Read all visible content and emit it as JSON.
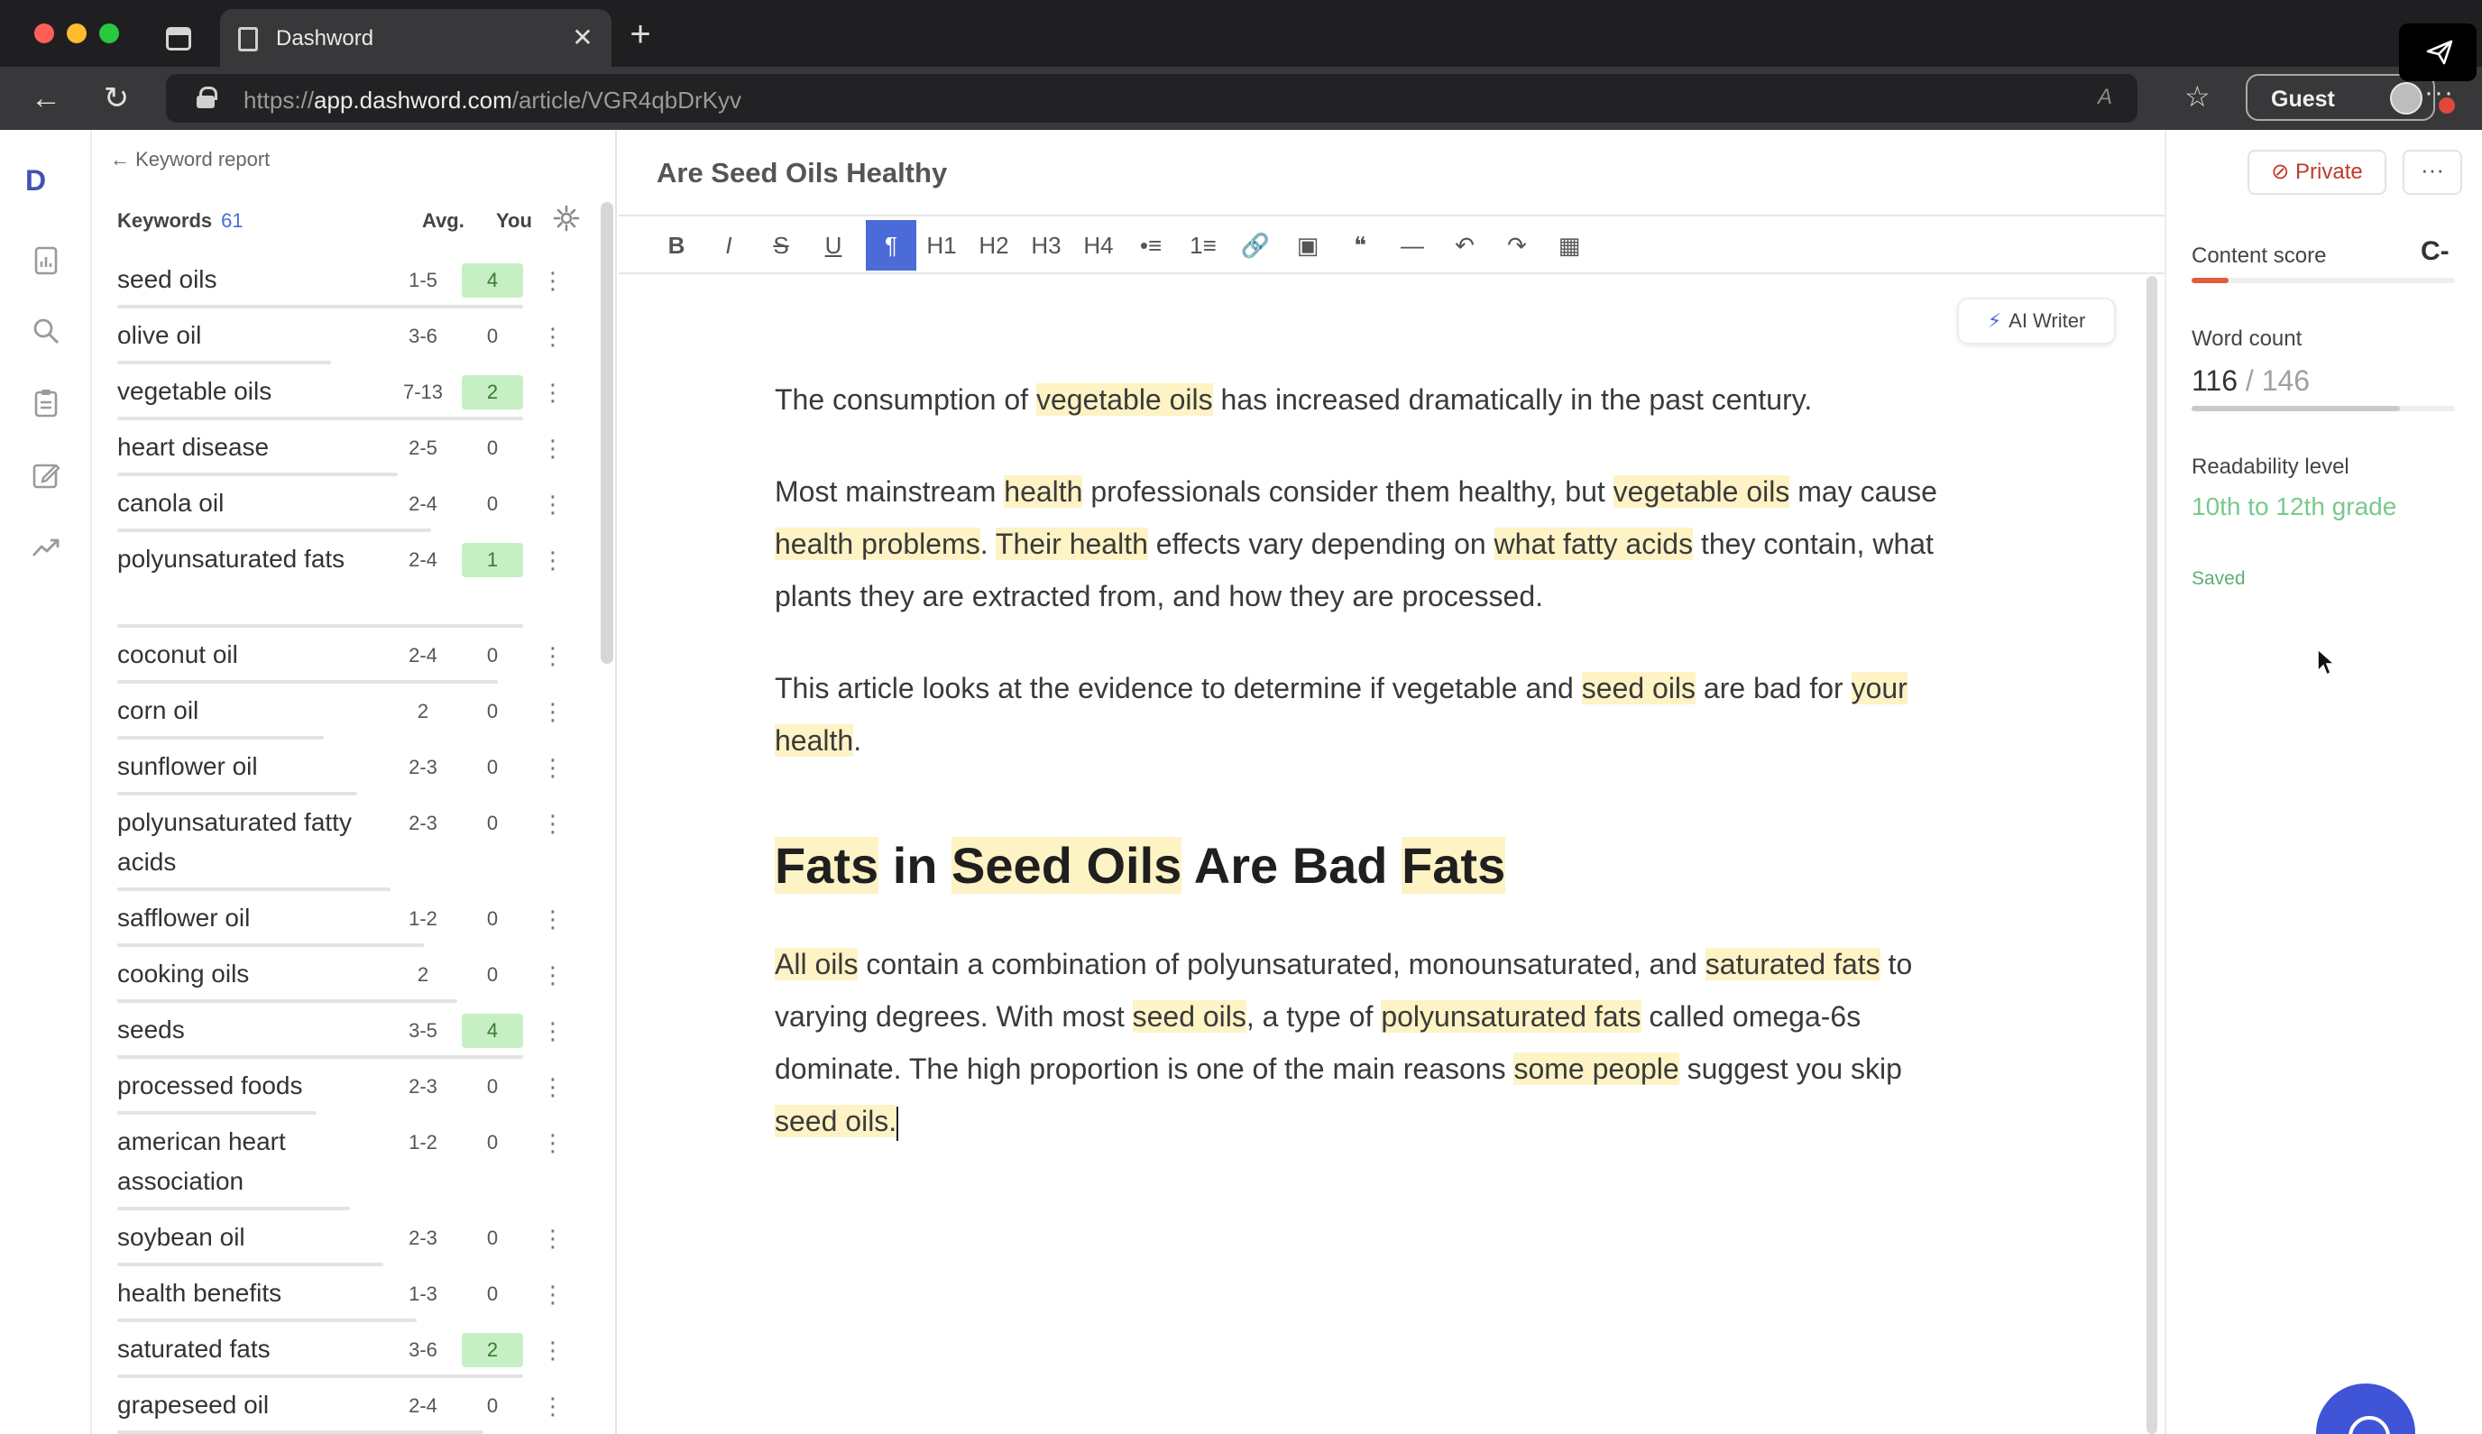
{
  "browser": {
    "tab_title": "Dashword",
    "url_prefix": "https://",
    "url_host": "app.dashword.com",
    "url_path": "/article/VGR4qbDrKyv",
    "read_aloud": "A",
    "profile_label": "Guest"
  },
  "app": {
    "logo": "D",
    "back_link": "← Keyword report",
    "keywords_header": "Keywords",
    "keywords_count": "61",
    "col_avg": "Avg.",
    "col_you": "You",
    "keywords": [
      {
        "name": "seed oils",
        "avg": "1-5",
        "you": "4",
        "hit": true
      },
      {
        "name": "olive oil",
        "avg": "3-6",
        "you": "0",
        "hit": false
      },
      {
        "name": "vegetable oils",
        "avg": "7-13",
        "you": "2",
        "hit": true
      },
      {
        "name": "heart disease",
        "avg": "2-5",
        "you": "0",
        "hit": false
      },
      {
        "name": "canola oil",
        "avg": "2-4",
        "you": "0",
        "hit": false
      },
      {
        "name": "polyunsaturated fats",
        "avg": "2-4",
        "you": "1",
        "hit": true
      },
      {
        "name": "coconut oil",
        "avg": "2-4",
        "you": "0",
        "hit": false
      },
      {
        "name": "corn oil",
        "avg": "2",
        "you": "0",
        "hit": false
      },
      {
        "name": "sunflower oil",
        "avg": "2-3",
        "you": "0",
        "hit": false
      },
      {
        "name": "polyunsaturated fatty acids",
        "avg": "2-3",
        "you": "0",
        "hit": false
      },
      {
        "name": "safflower oil",
        "avg": "1-2",
        "you": "0",
        "hit": false
      },
      {
        "name": "cooking oils",
        "avg": "2",
        "you": "0",
        "hit": false
      },
      {
        "name": "seeds",
        "avg": "3-5",
        "you": "4",
        "hit": true
      },
      {
        "name": "processed foods",
        "avg": "2-3",
        "you": "0",
        "hit": false
      },
      {
        "name": "american heart association",
        "avg": "1-2",
        "you": "0",
        "hit": false
      },
      {
        "name": "soybean oil",
        "avg": "2-3",
        "you": "0",
        "hit": false
      },
      {
        "name": "health benefits",
        "avg": "1-3",
        "you": "0",
        "hit": false
      },
      {
        "name": "saturated fats",
        "avg": "3-6",
        "you": "2",
        "hit": true
      },
      {
        "name": "grapeseed oil",
        "avg": "2-4",
        "you": "0",
        "hit": false
      }
    ],
    "editor": {
      "doc_title": "Are Seed Oils Healthy",
      "ai_writer_label": "AI Writer",
      "toolbar": [
        "B",
        "I",
        "S",
        "U",
        "¶",
        "H1",
        "H2",
        "H3",
        "H4",
        "•≡",
        "1≡",
        "🔗",
        "▣",
        "❝",
        "—",
        "↶",
        "↷",
        "▦"
      ],
      "paragraphs": [
        [
          {
            "t": "The consumption of "
          },
          {
            "t": "vegetable oils",
            "h": true
          },
          {
            "t": " has increased dramatically in the past century."
          }
        ],
        [
          {
            "t": "Most mainstream "
          },
          {
            "t": "health",
            "h": true
          },
          {
            "t": " professionals consider them healthy, but "
          },
          {
            "t": "vegetable oils",
            "h": true
          },
          {
            "t": " may cause "
          },
          {
            "t": "health problems",
            "h": true
          },
          {
            "t": ". "
          },
          {
            "t": "Their health",
            "h": true
          },
          {
            "t": " effects vary depending on "
          },
          {
            "t": "what fatty acids",
            "h": true
          },
          {
            "t": " they contain, what plants they are extracted from, and how they are processed."
          }
        ],
        [
          {
            "t": "This article looks at the evidence to determine if vegetable and "
          },
          {
            "t": "seed oils",
            "h": true
          },
          {
            "t": " are bad for "
          },
          {
            "t": "your health",
            "h": true
          },
          {
            "t": "."
          }
        ]
      ],
      "heading": [
        {
          "t": "Fats",
          "h": true
        },
        {
          "t": " in "
        },
        {
          "t": "Seed Oils",
          "h": true
        },
        {
          "t": " Are Bad "
        },
        {
          "t": "Fats",
          "h": true
        }
      ],
      "paragraph_after": [
        {
          "t": "All oils",
          "h": true
        },
        {
          "t": " contain a combination of polyunsaturated, monounsaturated, and "
        },
        {
          "t": "saturated fats",
          "h": true
        },
        {
          "t": " to varying degrees. With most "
        },
        {
          "t": "seed oils",
          "h": true
        },
        {
          "t": ", a type of "
        },
        {
          "t": "polyunsaturated fats",
          "h": true
        },
        {
          "t": " called omega-6s dominate. The high proportion is one of the main reasons "
        },
        {
          "t": "some people",
          "h": true
        },
        {
          "t": " suggest you skip "
        },
        {
          "t": "seed oils.",
          "h": true
        }
      ]
    },
    "sidebar_right": {
      "private_label": "Private",
      "more_label": "···",
      "content_score_label": "Content score",
      "content_score_grade": "C-",
      "content_score_fraction": 0.14,
      "word_count_label": "Word count",
      "word_count": "116",
      "word_count_target": "/ 146",
      "word_count_fraction": 0.79,
      "readability_label": "Readability level",
      "readability_value": "10th to 12th grade",
      "saved_label": "Saved"
    }
  },
  "colors": {
    "accent": "#4a6bd8",
    "highlight": "#fdf3c5",
    "keyword_hit_bg": "#c6efc3",
    "score_bar": "#e05d3c",
    "readability_green": "#79c98d",
    "private_red": "#c0392b"
  },
  "icons": {
    "rail": [
      "report-icon",
      "search-icon",
      "clipboard-icon",
      "edit-icon",
      "trend-icon"
    ]
  }
}
